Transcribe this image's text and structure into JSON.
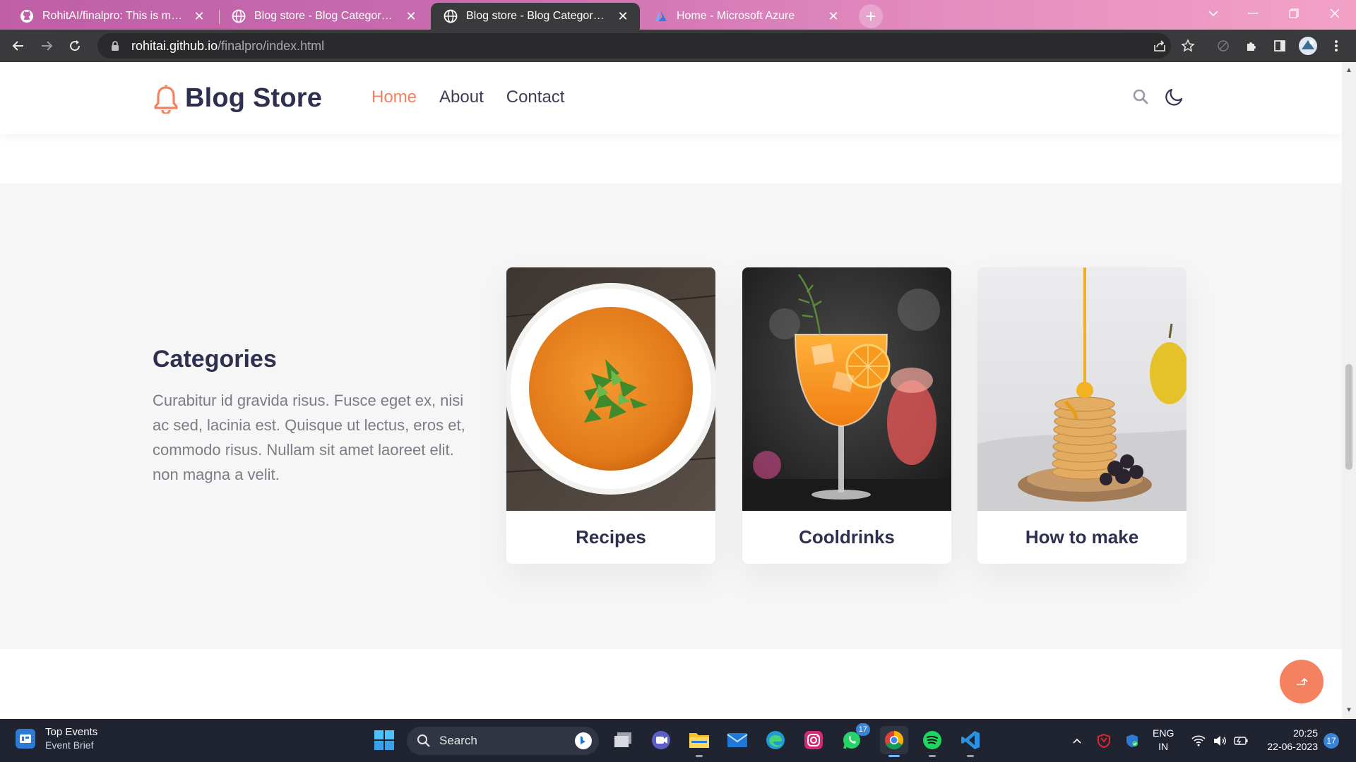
{
  "browser": {
    "tabs": [
      {
        "title": "RohitAI/finalpro: This is my final p",
        "icon": "github-icon",
        "active": false
      },
      {
        "title": "Blog store - Blog Category Boots",
        "icon": "globe-icon",
        "active": false
      },
      {
        "title": "Blog store - Blog Category Boots",
        "icon": "globe-icon",
        "active": true
      },
      {
        "title": "Home - Microsoft Azure",
        "icon": "azure-icon",
        "active": false
      }
    ],
    "new_tab_label": "+",
    "url_host": "rohitai.github.io",
    "url_path": "/finalpro/index.html"
  },
  "site": {
    "brand": "Blog Store",
    "nav": [
      {
        "label": "Home",
        "active": true
      },
      {
        "label": "About",
        "active": false
      },
      {
        "label": "Contact",
        "active": false
      }
    ],
    "accent_color": "#f4815f",
    "heading_color": "#2f3050"
  },
  "categories": {
    "title": "Categories",
    "description": "Curabitur id gravida risus. Fusce eget ex, nisi ac sed, lacinia est. Quisque ut lectus, eros et, commodo risus. Nullam sit amet laoreet elit. non magna a velit.",
    "cards": [
      {
        "label": "Recipes",
        "image": "soup-bowl"
      },
      {
        "label": "Cooldrinks",
        "image": "orange-cocktail"
      },
      {
        "label": "How to make",
        "image": "pancake-stack"
      }
    ]
  },
  "taskbar": {
    "widget_title": "Top Events",
    "widget_subtitle": "Event Brief",
    "search_placeholder": "Search",
    "whatsapp_badge": "17",
    "lang_line1": "ENG",
    "lang_line2": "IN",
    "time": "20:25",
    "date": "22-06-2023",
    "notifications": "17"
  }
}
